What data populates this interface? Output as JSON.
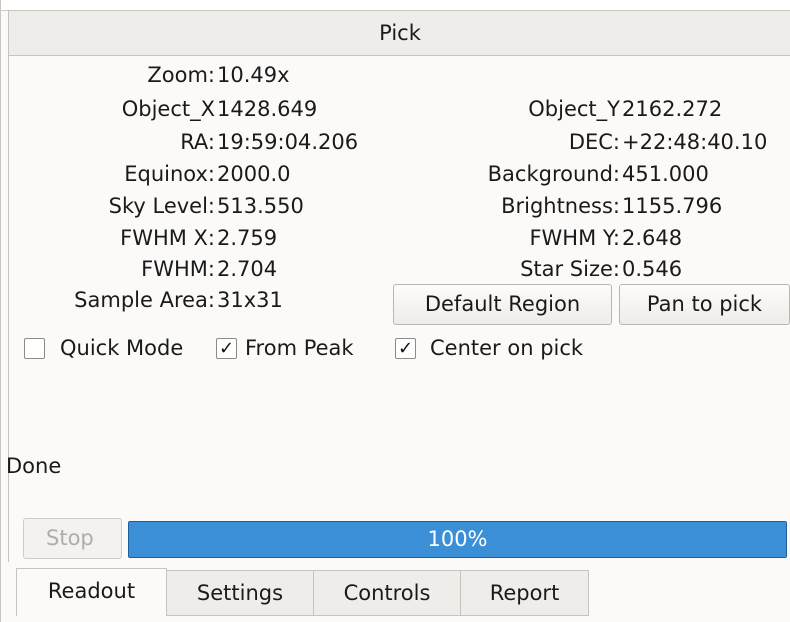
{
  "window": {
    "title": "Pick"
  },
  "readout": {
    "zoom_label": "Zoom:",
    "zoom_value": "10.49x",
    "object_x_label": "Object_X",
    "object_x_value": "1428.649",
    "object_y_label": "Object_Y",
    "object_y_value": "2162.272",
    "ra_label": "RA:",
    "ra_value": "19:59:04.206",
    "dec_label": "DEC:",
    "dec_value": "+22:48:40.10",
    "equinox_label": "Equinox:",
    "equinox_value": "2000.0",
    "background_label": "Background:",
    "background_value": "451.000",
    "sky_level_label": "Sky Level:",
    "sky_level_value": "513.550",
    "brightness_label": "Brightness:",
    "brightness_value": "1155.796",
    "fwhm_x_label": "FWHM X:",
    "fwhm_x_value": "2.759",
    "fwhm_y_label": "FWHM Y:",
    "fwhm_y_value": "2.648",
    "fwhm_label": "FWHM:",
    "fwhm_value": "2.704",
    "star_size_label": "Star Size:",
    "star_size_value": "0.546",
    "sample_area_label": "Sample Area:",
    "sample_area_value": "31x31"
  },
  "buttons": {
    "default_region": "Default Region",
    "pan_to_pick": "Pan to pick",
    "stop": "Stop"
  },
  "options": [
    {
      "label": "Quick Mode",
      "checked": false
    },
    {
      "label": "From Peak",
      "checked": true
    },
    {
      "label": "Center on pick",
      "checked": true
    }
  ],
  "check_glyph": "✓",
  "status": {
    "text": "Done"
  },
  "progress": {
    "fraction": 1.0,
    "label": "100%",
    "color": "#3a8fd6"
  },
  "tabs": [
    {
      "label": "Readout",
      "active": true
    },
    {
      "label": "Settings",
      "active": false
    },
    {
      "label": "Controls",
      "active": false
    },
    {
      "label": "Report",
      "active": false
    }
  ]
}
